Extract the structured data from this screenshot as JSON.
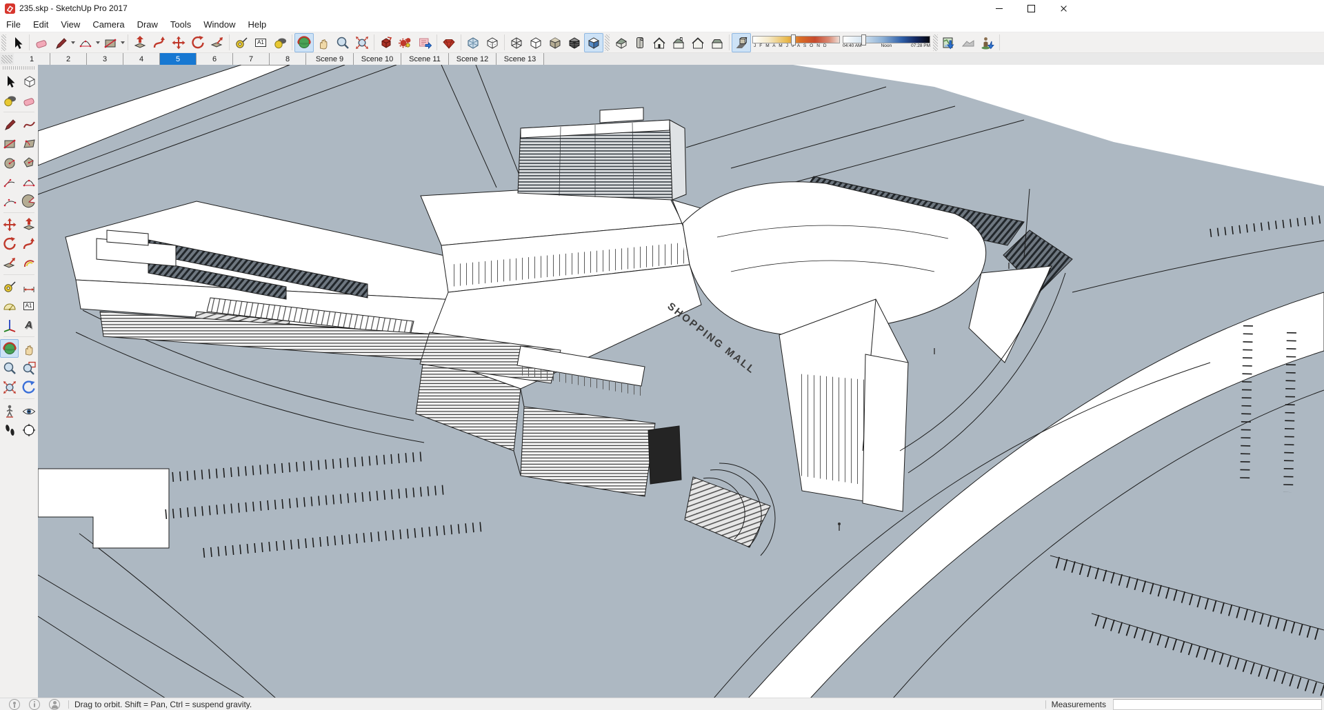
{
  "window": {
    "title": "235.skp - SketchUp Pro 2017",
    "controls": [
      "minimize-button",
      "maximize-button",
      "close-button"
    ]
  },
  "menu": {
    "items": [
      "File",
      "Edit",
      "View",
      "Camera",
      "Draw",
      "Tools",
      "Window",
      "Help"
    ]
  },
  "toolbar": {
    "text_tool_label": "A1",
    "active_camera_tool": "orbit",
    "active_face_style": "monochrome",
    "shadow_dialog_active": true,
    "groups": [
      {
        "name": "select",
        "icons": [
          "select"
        ]
      },
      {
        "name": "draw",
        "icons": [
          "eraser",
          "line",
          "arc",
          "rectangle"
        ]
      },
      {
        "name": "modify",
        "icons": [
          "push-pull",
          "follow-me",
          "move",
          "rotate",
          "scale"
        ]
      },
      {
        "name": "construction",
        "icons": [
          "tape-measure",
          "text",
          "paint-bucket"
        ]
      },
      {
        "name": "camera",
        "icons": [
          "orbit",
          "pan",
          "zoom",
          "zoom-extents"
        ]
      },
      {
        "name": "plugins",
        "icons": [
          "plugin-box",
          "plugin-gears",
          "plugin-export",
          "ruby-console"
        ]
      },
      {
        "name": "face-styles",
        "icons": [
          "x-ray",
          "back-edges",
          "wireframe",
          "hidden-line",
          "shaded",
          "shaded-with-textures",
          "monochrome"
        ]
      },
      {
        "name": "views",
        "icons": [
          "iso",
          "top",
          "front",
          "right",
          "back",
          "left"
        ]
      },
      {
        "name": "shadows",
        "icons": [
          "shadow-settings"
        ]
      },
      {
        "name": "location",
        "icons": [
          "add-location",
          "toggle-terrain",
          "photo-textures"
        ]
      }
    ]
  },
  "shadows": {
    "months": "J F M A M J J A S O N D",
    "date_handle_pct": 44,
    "time_start": "04:40 AM",
    "time_mid": "Noon",
    "time_end": "07:28 PM",
    "time_handle_pct": 21
  },
  "scenes": {
    "active": "5",
    "tabs": [
      "1",
      "2",
      "3",
      "4",
      "5",
      "6",
      "7",
      "8",
      "Scene 9",
      "Scene 10",
      "Scene 11",
      "Scene 12",
      "Scene 13"
    ]
  },
  "palette": {
    "active_tool": "orbit",
    "text3d_label": "A",
    "tools": [
      "select",
      "make-component",
      "paint-bucket",
      "eraser",
      "line",
      "freehand",
      "rectangle",
      "rotated-rectangle",
      "circle",
      "polygon",
      "arc",
      "two-point-arc",
      "three-point-arc",
      "pie",
      "move",
      "push-pull",
      "rotate",
      "follow-me",
      "scale",
      "offset",
      "tape-measure",
      "dimension",
      "protractor",
      "text",
      "axes",
      "3d-text",
      "orbit",
      "pan",
      "zoom",
      "zoom-window",
      "zoom-extents",
      "previous",
      "position-camera",
      "look-around",
      "walk",
      "section-compass"
    ]
  },
  "viewport": {
    "sign": "SHOPPING MALL"
  },
  "status": {
    "icons": [
      "geolocation-icon",
      "credits-icon",
      "sign-in-icon"
    ],
    "hint": "Drag to orbit. Shift = Pan, Ctrl = suspend gravity.",
    "measurements_label": "Measurements",
    "measurements_value": ""
  },
  "colors": {
    "active_scene_tab": "#1778d2",
    "tool_highlight": "#cde2f6",
    "ground": "#adb8c2",
    "sketchup_red": "#d7362d",
    "model_face": "#ffffff",
    "model_edge": "#1c1c1c"
  }
}
